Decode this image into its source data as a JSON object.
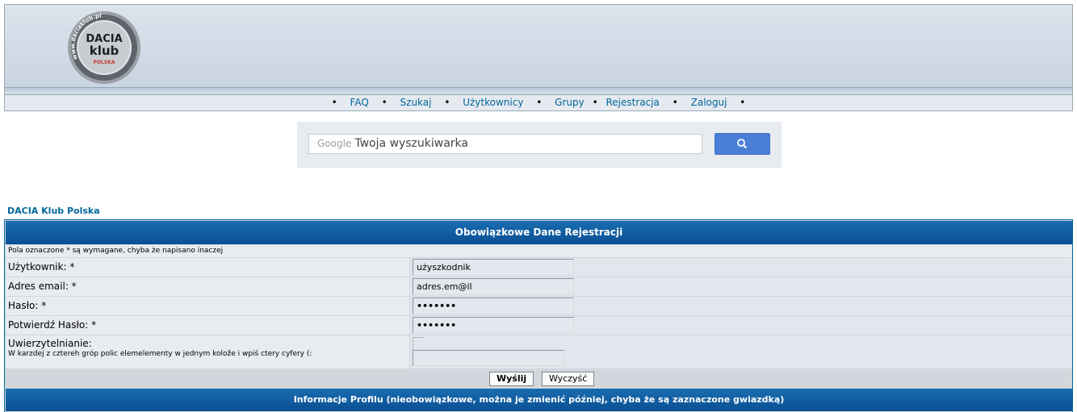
{
  "header": {
    "logo": {
      "ring_text": "www.daciaklub.pl",
      "line1": "DACIA",
      "line2": "klub",
      "line3": "POLSKA"
    }
  },
  "nav": {
    "items": [
      {
        "label": "FAQ"
      },
      {
        "label": "Szukaj"
      },
      {
        "label": "Użytkownicy"
      },
      {
        "label": "Grupy"
      },
      {
        "label": "Rejestracja"
      },
      {
        "label": "Zaloguj"
      }
    ],
    "bullet": "•"
  },
  "search": {
    "brand": "Google",
    "placeholder": "Twoja wyszukiwarka"
  },
  "breadcrumb": {
    "forum_name": "DACIA Klub Polska"
  },
  "form": {
    "header_required": "Obowiązkowe Dane Rejestracji",
    "note": "Pola oznaczone * są wymagane, chyba że napisano inaczej",
    "fields": [
      {
        "label": "Użytkownik: *",
        "value": "użyszkodnik"
      },
      {
        "label": "Adres email: *",
        "value": "adres.em@il"
      },
      {
        "label": "Hasło: *",
        "value": "•••••••"
      },
      {
        "label": "Potwierdź Hasło: *",
        "value": "•••••••"
      }
    ],
    "captcha": {
      "label": "Uwierzytelnianie:",
      "hint": "W karzdej z cztereh grόp polic elemelementy w jednym kolože i wpiś ctery cyfery (:"
    },
    "submit_label": "Wyślij",
    "reset_label": "Wyczyść",
    "header_profile": "Informacje Profilu (nieobowiązkowe, można je zmienić później, chyba że są zaznaczone gwiazdką)"
  }
}
